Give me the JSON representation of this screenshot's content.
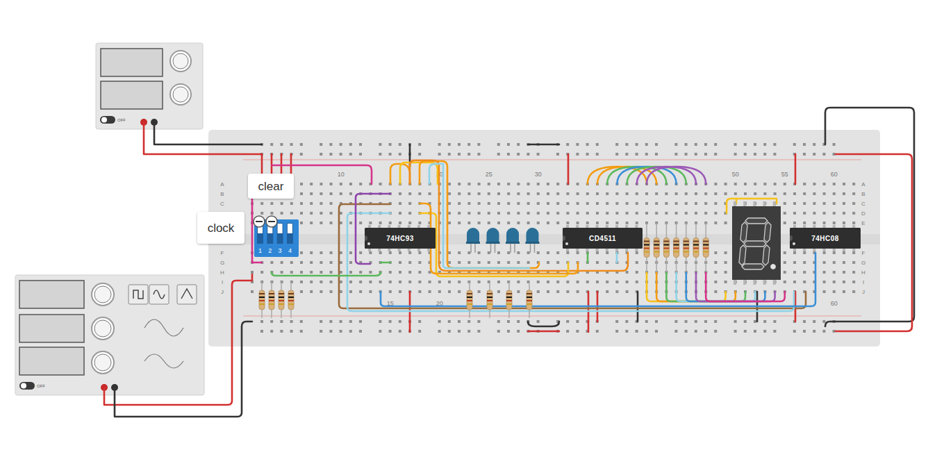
{
  "tooltips": [
    {
      "text": "clear"
    },
    {
      "text": "clock"
    }
  ],
  "chips": [
    {
      "label": "74HC93"
    },
    {
      "label": "CD4511"
    },
    {
      "label": "74HC08"
    }
  ],
  "breadboard": {
    "rows": [
      "A",
      "B",
      "C",
      "D",
      "E",
      "F",
      "G",
      "H",
      "I",
      "J"
    ],
    "top_column_numbers": [
      "10",
      "20",
      "25",
      "30",
      "50",
      "55",
      "60"
    ],
    "bottom_column_numbers": [
      "15",
      "20",
      "60"
    ]
  },
  "dip_switch": {
    "switches": [
      {
        "label": "1",
        "on": false
      },
      {
        "label": "2",
        "on": false
      },
      {
        "label": "3",
        "on": false
      },
      {
        "label": "4",
        "on": false
      }
    ]
  },
  "leds": [
    {
      "on": false
    },
    {
      "on": false
    },
    {
      "on": false
    },
    {
      "on": false
    }
  ],
  "seven_segment": {
    "segments": [
      {
        "name": "a",
        "on": false
      },
      {
        "name": "b",
        "on": false
      },
      {
        "name": "c",
        "on": false
      },
      {
        "name": "d",
        "on": false
      },
      {
        "name": "e",
        "on": false
      },
      {
        "name": "f",
        "on": false
      },
      {
        "name": "g",
        "on": false
      },
      {
        "name": "dp",
        "on": false
      }
    ]
  },
  "power_supply": {
    "switch_label": "OFF",
    "on": false
  },
  "function_generator": {
    "switch_label": "OFF",
    "on": false
  }
}
